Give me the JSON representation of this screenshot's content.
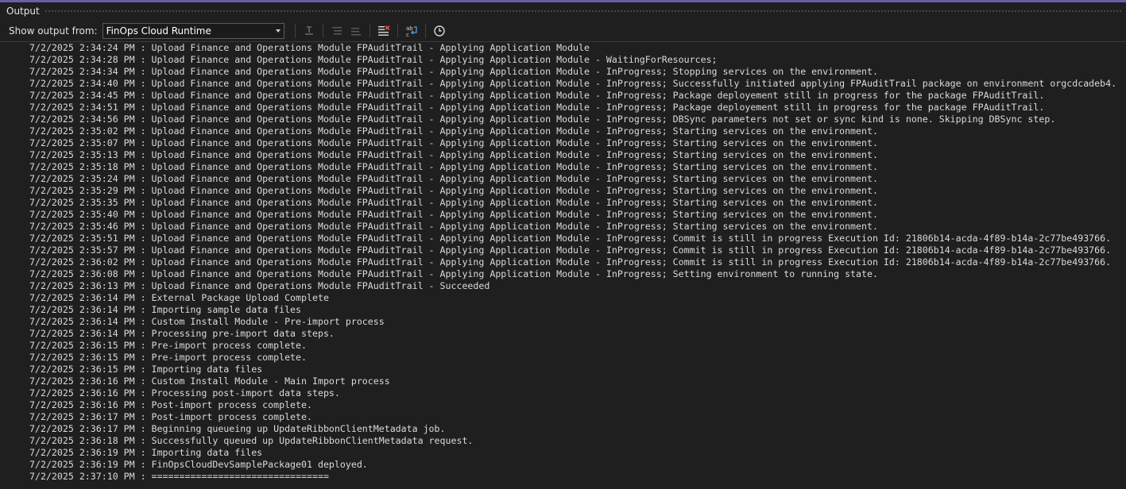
{
  "panel": {
    "title": "Output"
  },
  "toolbar": {
    "show_output_label": "Show output from:",
    "source_selected": "FinOps Cloud Runtime",
    "buttons": [
      {
        "icon": "go-to-line-icon",
        "enabled": false
      },
      {
        "icon": "previous-message-icon",
        "enabled": false
      },
      {
        "icon": "next-message-icon",
        "enabled": false
      },
      {
        "icon": "clear-all-icon",
        "enabled": true
      },
      {
        "icon": "toggle-word-wrap-icon",
        "enabled": true
      },
      {
        "icon": "toggle-timestamps-icon",
        "enabled": true
      }
    ]
  },
  "colors": {
    "accent": "#6e5ba7",
    "background": "#1f1f1f",
    "text": "#dadada",
    "clear_icon_red": "#e05252",
    "wrap_icon_blue": "#4fa3e8"
  },
  "log_lines": [
    "7/2/2025 2:34:24 PM : Upload Finance and Operations Module FPAuditTrail - Applying Application Module",
    "7/2/2025 2:34:28 PM : Upload Finance and Operations Module FPAuditTrail - Applying Application Module - WaitingForResources;",
    "7/2/2025 2:34:34 PM : Upload Finance and Operations Module FPAuditTrail - Applying Application Module - InProgress; Stopping services on the environment.",
    "7/2/2025 2:34:40 PM : Upload Finance and Operations Module FPAuditTrail - Applying Application Module - InProgress; Successfully initiated applying FPAuditTrail package on environment orgcdcadeb4.",
    "7/2/2025 2:34:45 PM : Upload Finance and Operations Module FPAuditTrail - Applying Application Module - InProgress; Package deployement still in progress for the package FPAuditTrail.",
    "7/2/2025 2:34:51 PM : Upload Finance and Operations Module FPAuditTrail - Applying Application Module - InProgress; Package deployement still in progress for the package FPAuditTrail.",
    "7/2/2025 2:34:56 PM : Upload Finance and Operations Module FPAuditTrail - Applying Application Module - InProgress; DBSync parameters not set or sync kind is none. Skipping DBSync step.",
    "7/2/2025 2:35:02 PM : Upload Finance and Operations Module FPAuditTrail - Applying Application Module - InProgress; Starting services on the environment.",
    "7/2/2025 2:35:07 PM : Upload Finance and Operations Module FPAuditTrail - Applying Application Module - InProgress; Starting services on the environment.",
    "7/2/2025 2:35:13 PM : Upload Finance and Operations Module FPAuditTrail - Applying Application Module - InProgress; Starting services on the environment.",
    "7/2/2025 2:35:18 PM : Upload Finance and Operations Module FPAuditTrail - Applying Application Module - InProgress; Starting services on the environment.",
    "7/2/2025 2:35:24 PM : Upload Finance and Operations Module FPAuditTrail - Applying Application Module - InProgress; Starting services on the environment.",
    "7/2/2025 2:35:29 PM : Upload Finance and Operations Module FPAuditTrail - Applying Application Module - InProgress; Starting services on the environment.",
    "7/2/2025 2:35:35 PM : Upload Finance and Operations Module FPAuditTrail - Applying Application Module - InProgress; Starting services on the environment.",
    "7/2/2025 2:35:40 PM : Upload Finance and Operations Module FPAuditTrail - Applying Application Module - InProgress; Starting services on the environment.",
    "7/2/2025 2:35:46 PM : Upload Finance and Operations Module FPAuditTrail - Applying Application Module - InProgress; Starting services on the environment.",
    "7/2/2025 2:35:51 PM : Upload Finance and Operations Module FPAuditTrail - Applying Application Module - InProgress; Commit is still in progress Execution Id: 21806b14-acda-4f89-b14a-2c77be493766.",
    "7/2/2025 2:35:57 PM : Upload Finance and Operations Module FPAuditTrail - Applying Application Module - InProgress; Commit is still in progress Execution Id: 21806b14-acda-4f89-b14a-2c77be493766.",
    "7/2/2025 2:36:02 PM : Upload Finance and Operations Module FPAuditTrail - Applying Application Module - InProgress; Commit is still in progress Execution Id: 21806b14-acda-4f89-b14a-2c77be493766.",
    "7/2/2025 2:36:08 PM : Upload Finance and Operations Module FPAuditTrail - Applying Application Module - InProgress; Setting environment to running state.",
    "7/2/2025 2:36:13 PM : Upload Finance and Operations Module FPAuditTrail - Succeeded",
    "7/2/2025 2:36:14 PM : External Package Upload Complete",
    "7/2/2025 2:36:14 PM : Importing sample data files",
    "7/2/2025 2:36:14 PM : Custom Install Module - Pre-import process",
    "7/2/2025 2:36:14 PM : Processing pre-import data steps.",
    "7/2/2025 2:36:15 PM : Pre-import process complete.",
    "7/2/2025 2:36:15 PM : Pre-import process complete.",
    "7/2/2025 2:36:15 PM : Importing data files",
    "7/2/2025 2:36:16 PM : Custom Install Module - Main Import process",
    "7/2/2025 2:36:16 PM : Processing post-import data steps.",
    "7/2/2025 2:36:16 PM : Post-import process complete.",
    "7/2/2025 2:36:17 PM : Post-import process complete.",
    "7/2/2025 2:36:17 PM : Beginning queueing up UpdateRibbonClientMetadata job.",
    "7/2/2025 2:36:18 PM : Successfully queued up UpdateRibbonClientMetadata request.",
    "7/2/2025 2:36:19 PM : Importing data files",
    "7/2/2025 2:36:19 PM : FinOpsCloudDevSamplePackage01 deployed.",
    "7/2/2025 2:37:10 PM : ================================"
  ]
}
